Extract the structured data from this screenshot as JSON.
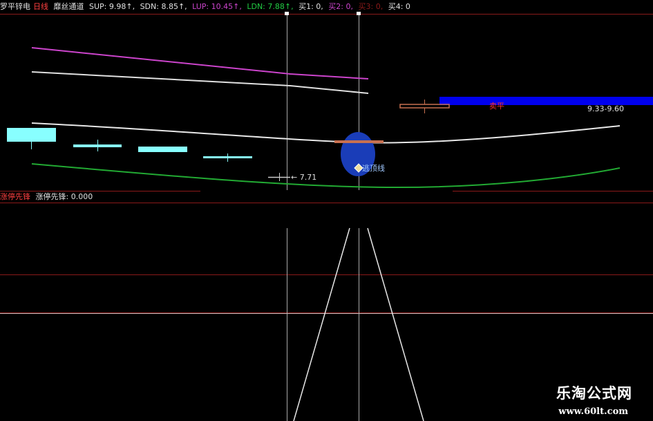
{
  "header": {
    "stock_name": "罗平锌电",
    "period": "日线",
    "indicator_name": "靡丝通道",
    "sup": "SUP: 9.98↑,",
    "sdn": "SDN: 8.85↑,",
    "lup": "LUP: 10.45↑,",
    "ldn": "LDN: 7.88↑,",
    "buy1": "买1: 0,",
    "buy2": "买2: 0,",
    "buy3": "买3: 0,",
    "buy4": "买4: 0"
  },
  "main_chart": {
    "sell_label": "卖平",
    "range_label": "9.33-9.60",
    "low_label": "← 7.71",
    "signal_label": "逃顶线"
  },
  "sub_chart": {
    "name": "涨停先锋",
    "value_label": "涨停先锋: 0.000"
  },
  "watermark": {
    "title": "乐淘公式网",
    "url": "www.60lt.com"
  },
  "colors": {
    "background": "#000000",
    "sup_line": "#e0e0e0",
    "sdn_line": "#ffffff",
    "lup_line": "#cc44cc",
    "ldn_line": "#22aa33",
    "candle": "#88ffff",
    "sell_bar": "#0000ee",
    "signal_ellipse": "#1a3db8",
    "grid": "#8b1a1a"
  }
}
